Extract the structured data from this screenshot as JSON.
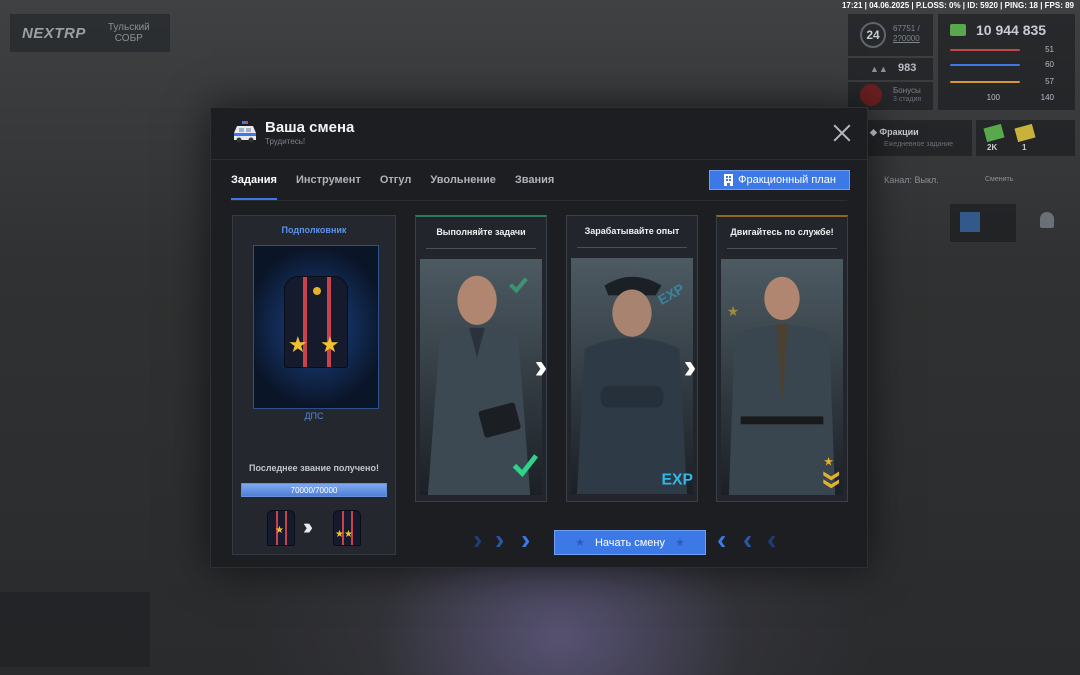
{
  "hud": {
    "logo": "NEXTRP",
    "city": "Тульский",
    "city_sub": "СОБР",
    "top_status": "17:21 | 04.06.2025 | P.LOSS: 0% | ID: 5920 | PING: 18 | FPS: 89",
    "level": "24",
    "exp_text": "67751 /",
    "exp_sub": "2?0000",
    "likes": "983",
    "money": "10 944 835",
    "stat1": "51",
    "stat2": "60",
    "stat3": "57",
    "stat4a": "100",
    "stat4b": "140",
    "bonus_label": "Бонусы",
    "bonus_sub": "3 стадия",
    "factions_label": "Фракции",
    "factions_sub": "Ежедневное задание",
    "cash1": "2K",
    "cash2": "1",
    "channel": "Канал: Выкл.",
    "change": "Сменить",
    "colors": {
      "accent": "#3c79e6",
      "stripe": "#c8434e",
      "check": "#2fd48a",
      "exp": "#32b7e6",
      "gold": "#e3b12c"
    }
  },
  "modal": {
    "title": "Ваша смена",
    "subtitle": "Трудитесь!",
    "tabs": [
      "Задания",
      "Инструмент",
      "Отгул",
      "Увольнение",
      "Звания"
    ],
    "active_tab": 0,
    "plan_button": "Фракционный план",
    "rank": {
      "name": "Подполковник",
      "unit": "ДПС",
      "last_rank_text": "Последнее звание получено!",
      "progress_text": "70000/70000",
      "progress": 1.0
    },
    "steps": [
      {
        "title": "Выполняйте задачи",
        "badge": "check-icon"
      },
      {
        "title": "Зарабатывайте опыт",
        "badge": "EXP"
      },
      {
        "title": "Двигайтесь по службе!",
        "badge": "rank-chevron-icon"
      }
    ],
    "start_button": "Начать смену"
  }
}
